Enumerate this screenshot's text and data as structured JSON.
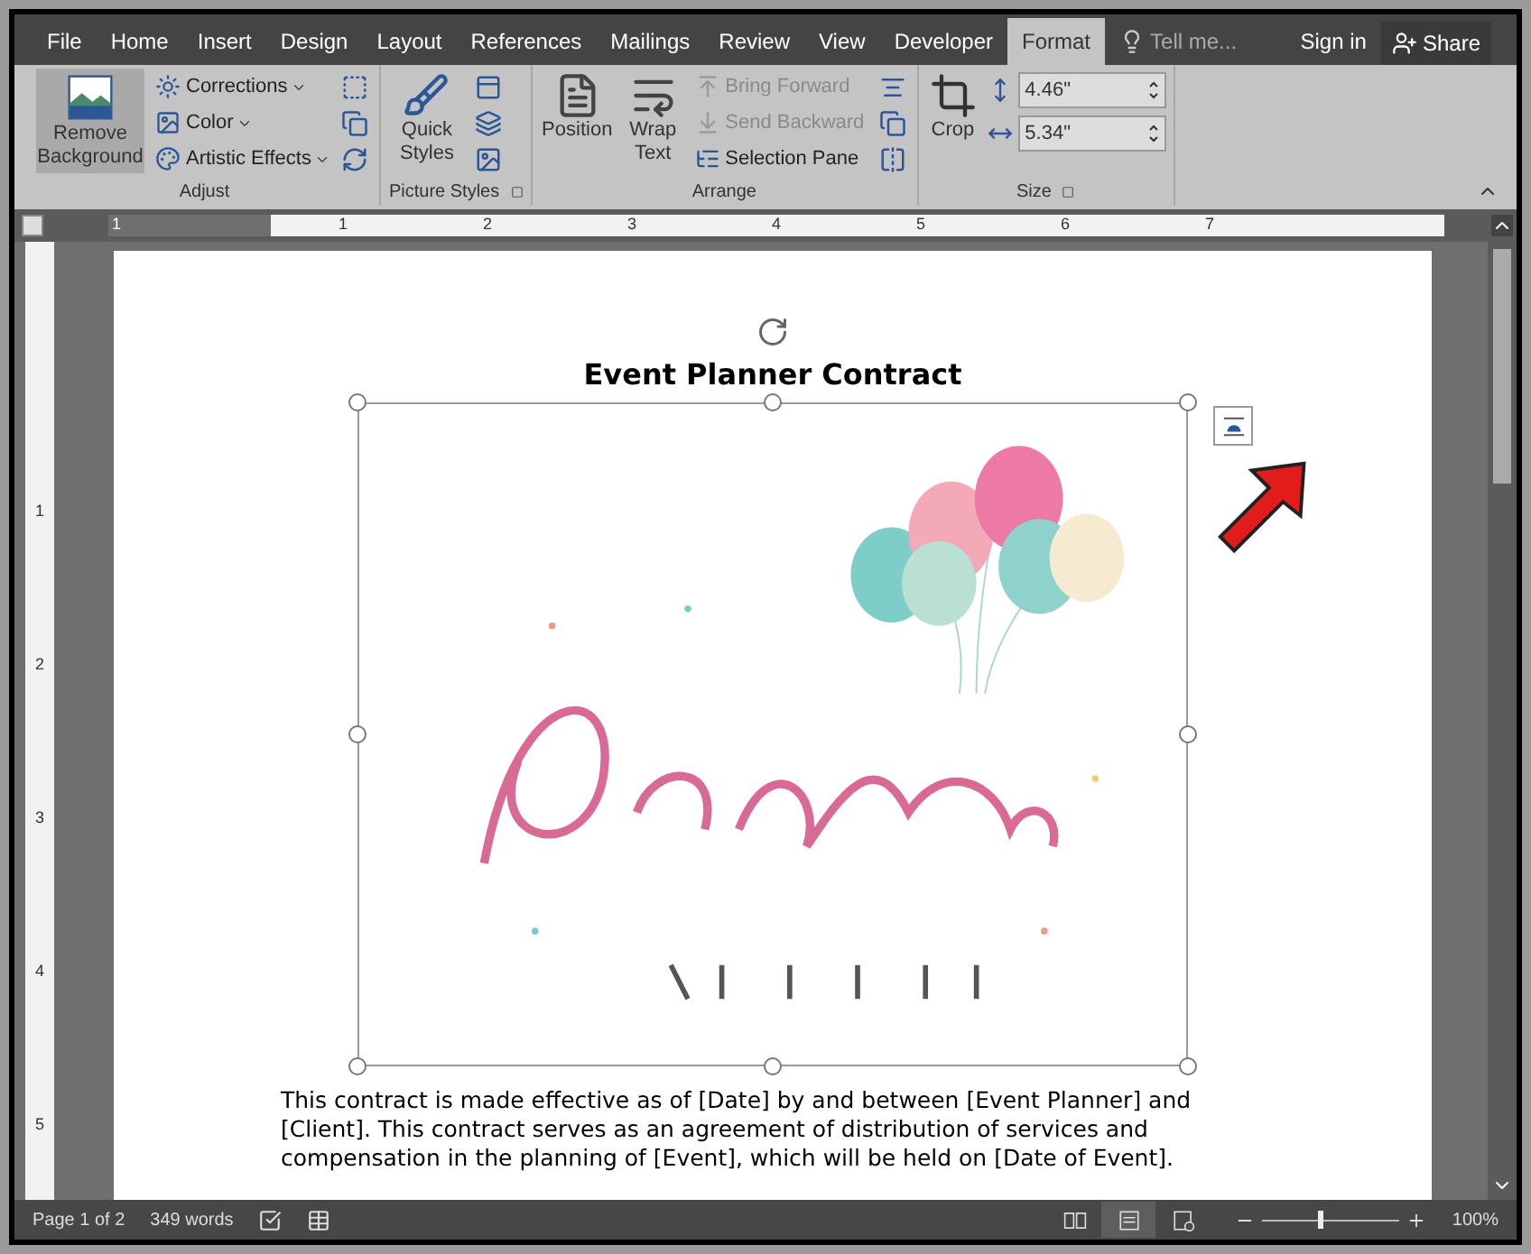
{
  "tabs": [
    {
      "label": "File",
      "selected": false
    },
    {
      "label": "Home",
      "selected": false
    },
    {
      "label": "Insert",
      "selected": false
    },
    {
      "label": "Design",
      "selected": false
    },
    {
      "label": "Layout",
      "selected": false
    },
    {
      "label": "References",
      "selected": false
    },
    {
      "label": "Mailings",
      "selected": false
    },
    {
      "label": "Review",
      "selected": false
    },
    {
      "label": "View",
      "selected": false
    },
    {
      "label": "Developer",
      "selected": false
    },
    {
      "label": "Format",
      "selected": true
    }
  ],
  "tell_me": {
    "placeholder": "Tell me..."
  },
  "sign_in": "Sign in",
  "share": "Share",
  "ribbon": {
    "adjust": {
      "label": "Adjust",
      "remove_background": {
        "label": "Remove Background",
        "selected": true
      },
      "items": [
        {
          "label": "Corrections"
        },
        {
          "label": "Color"
        },
        {
          "label": "Artistic Effects"
        }
      ]
    },
    "picture_styles": {
      "label": "Picture Styles",
      "quick_styles": "Quick Styles"
    },
    "arrange": {
      "label": "Arrange",
      "position": "Position",
      "wrap_text": "Wrap Text",
      "items": [
        {
          "label": "Bring Forward",
          "disabled": true
        },
        {
          "label": "Send Backward",
          "disabled": true
        },
        {
          "label": "Selection Pane",
          "disabled": false
        }
      ]
    },
    "size": {
      "label": "Size",
      "crop": "Crop",
      "height": "4.46\"",
      "width": "5.34\""
    }
  },
  "ruler": {
    "horizontal": [
      "1",
      "1",
      "2",
      "3",
      "4",
      "5",
      "6",
      "7"
    ],
    "vertical": [
      "1",
      "2",
      "3",
      "4",
      "5"
    ]
  },
  "document": {
    "title": "Event Planner Contract",
    "paragraph": "This contract is made effective as of [Date] by and between [Event Planner] and [Client]. This contract serves as an agreement of distribution of services and compensation in the planning of [Event], which will be held on [Date of Event]."
  },
  "status_bar": {
    "page": "Page 1 of 2",
    "words": "349 words",
    "views": [
      {
        "selected": false
      },
      {
        "selected": true
      },
      {
        "selected": false
      }
    ],
    "zoom": {
      "level": 0.4,
      "reading": "100%"
    }
  }
}
